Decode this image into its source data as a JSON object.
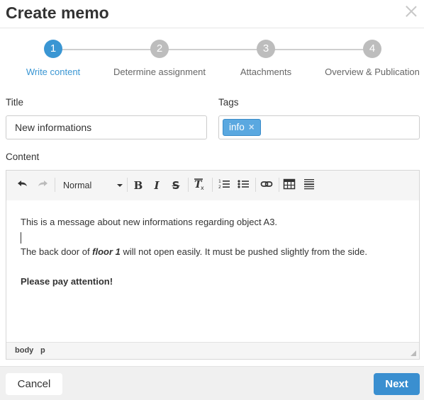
{
  "dialog": {
    "title": "Create memo"
  },
  "steps": [
    {
      "number": "1",
      "label": "Write content",
      "active": true
    },
    {
      "number": "2",
      "label": "Determine assignment",
      "active": false
    },
    {
      "number": "3",
      "label": "Attachments",
      "active": false
    },
    {
      "number": "4",
      "label": "Overview & Publication",
      "active": false
    }
  ],
  "form": {
    "title_label": "Title",
    "title_value": "New informations",
    "tags_label": "Tags",
    "tags": [
      {
        "label": "info",
        "remove": "×"
      }
    ],
    "content_label": "Content"
  },
  "toolbar": {
    "undo_icon": "undo-icon",
    "redo_icon": "redo-icon",
    "format_value": "Normal",
    "bold": "B",
    "italic": "I",
    "strike": "S",
    "clear": "Tx",
    "ordered_list_icon": "ordered-list-icon",
    "bullet_list_icon": "bullet-list-icon",
    "link_icon": "link-icon",
    "table_icon": "table-icon",
    "hr_icon": "horizontal-rule-icon"
  },
  "content": {
    "line1": "This is a message about new informations regarding object A3.",
    "line3_before": "The back door of ",
    "line3_emphasis": "floor 1",
    "line3_after": " will not open easily. It must be pushed slightly from the side.",
    "line5": "Please pay attention!"
  },
  "statusbar": {
    "path": [
      "body",
      "p"
    ]
  },
  "footer": {
    "cancel_label": "Cancel",
    "next_label": "Next"
  },
  "colors": {
    "accent": "#3a96d3",
    "inactive_step": "#bdbdbd",
    "tag_bg": "#5aa8e0",
    "primary_button": "#3a8fd0"
  }
}
